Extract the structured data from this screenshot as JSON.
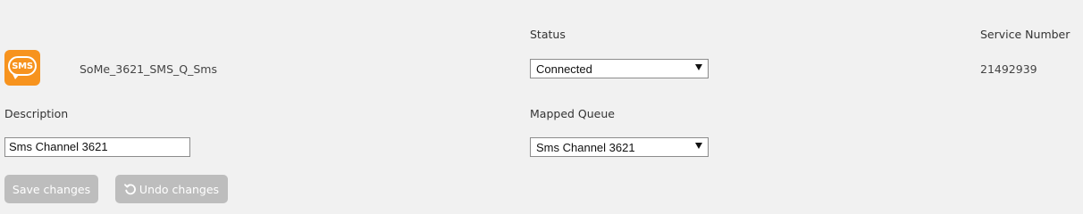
{
  "channel": {
    "icon": "sms-chat-icon",
    "icon_text": "SMS",
    "name": "SoMe_3621_SMS_Q_Sms",
    "icon_color": "#f7931e"
  },
  "status": {
    "label": "Status",
    "value": "Connected"
  },
  "service_number": {
    "label": "Service Number",
    "value": "21492939"
  },
  "description": {
    "label": "Description",
    "value": "Sms Channel 3621"
  },
  "mapped_queue": {
    "label": "Mapped Queue",
    "value": "Sms Channel 3621"
  },
  "actions": {
    "save_label": "Save changes",
    "undo_label": "Undo changes",
    "undo_icon": "undo-icon",
    "button_color": "#bdbdbd"
  }
}
